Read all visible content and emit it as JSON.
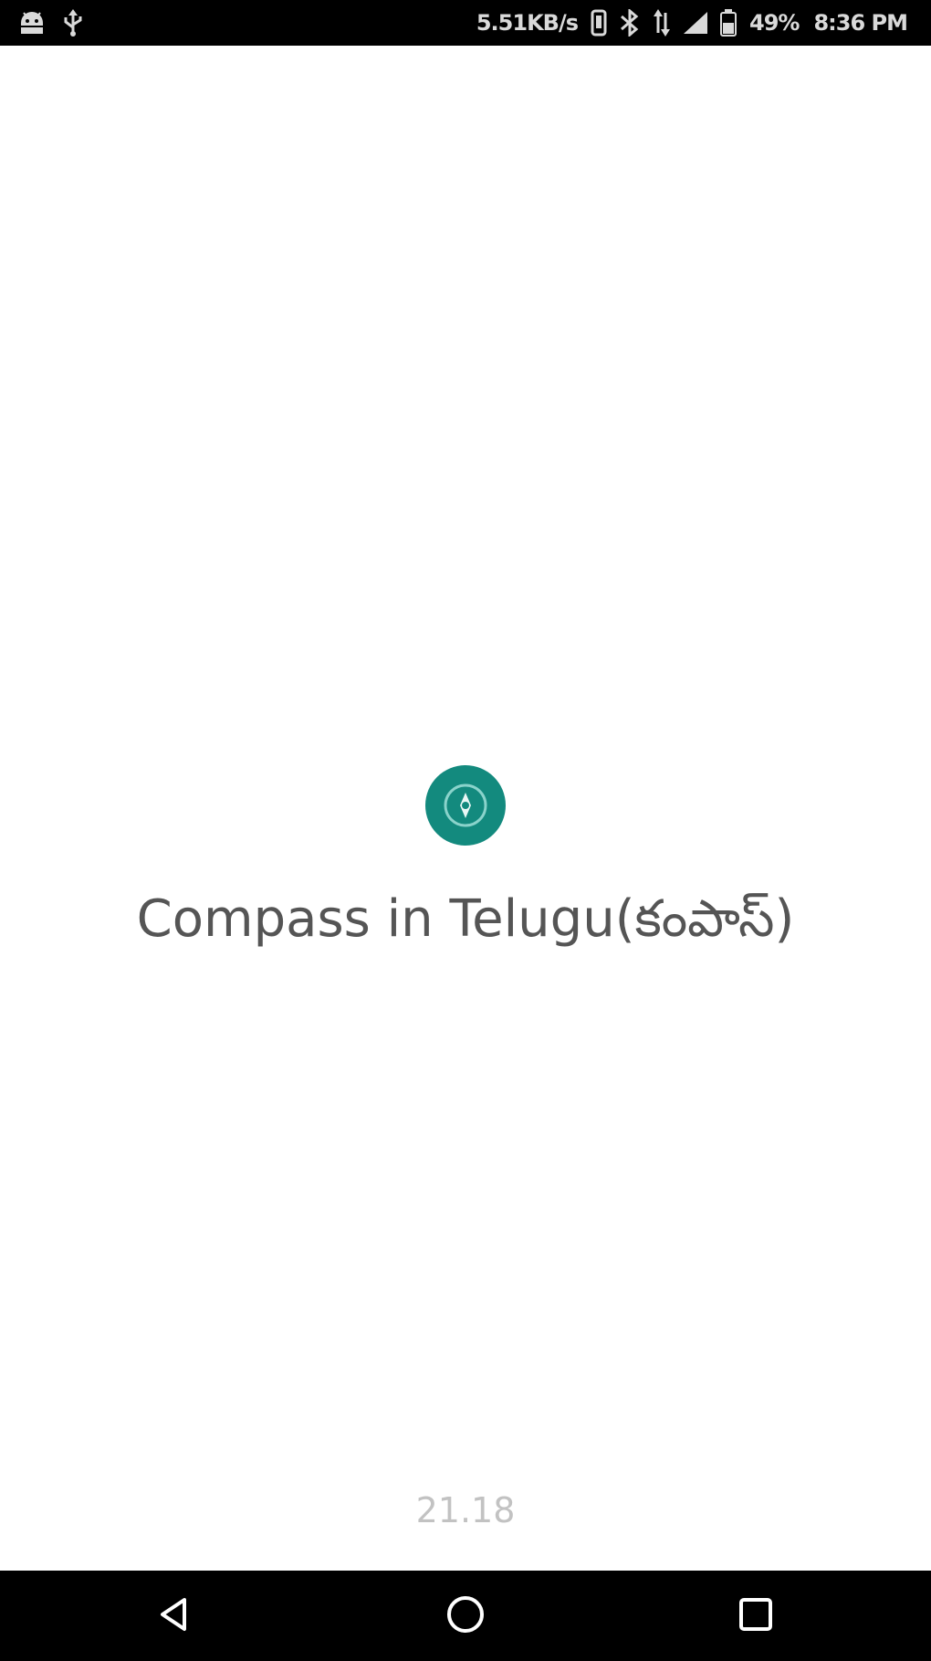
{
  "status_bar": {
    "network_speed": "5.51KB/s",
    "battery": "49%",
    "time": "8:36 PM",
    "icons": [
      "android-debug-icon",
      "usb-icon",
      "vibrate-icon",
      "bluetooth-icon",
      "data-arrows-icon",
      "signal-icon",
      "battery-icon"
    ]
  },
  "splash": {
    "app_name": "Compass in Telugu(కంపాస్)",
    "version": "21.18",
    "icon": "compass-icon",
    "accent_color": "#138a7e"
  },
  "nav_bar": {
    "icons": [
      "back-icon",
      "home-icon",
      "recents-icon"
    ]
  }
}
